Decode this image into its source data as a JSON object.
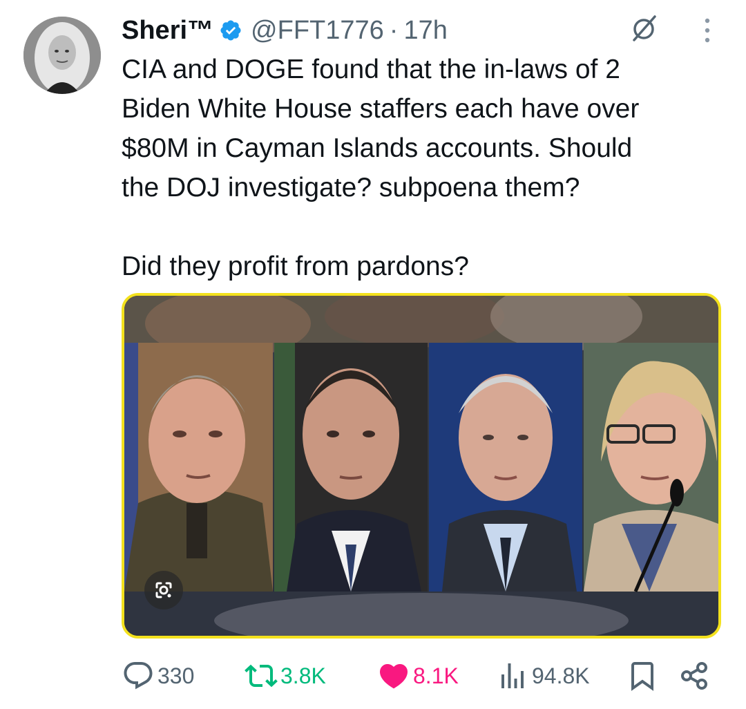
{
  "tweet": {
    "display_name": "Sheri™",
    "handle": "@FFT1776",
    "separator": "·",
    "time": "17h",
    "text_lines": [
      "CIA and DOGE found that the in-laws of 2",
      "Biden White House staffers each have over",
      "$80M in Cayman Islands accounts.  Should",
      "the DOJ investigate? subpoena them?"
    ],
    "text_para2": "Did they profit from pardons?"
  },
  "icons": {
    "verified": "verified-badge-icon",
    "grok": "grok-icon",
    "more": "more-vertical-icon",
    "lens": "google-lens-icon"
  },
  "stats": {
    "replies": "330",
    "retweets": "3.8K",
    "likes": "8.1K",
    "views": "94.8K"
  },
  "colors": {
    "verified": "#1d9bf0",
    "retweet": "#00ba7c",
    "like": "#f91880",
    "muted": "#536471",
    "media_border": "#f3e11d"
  }
}
